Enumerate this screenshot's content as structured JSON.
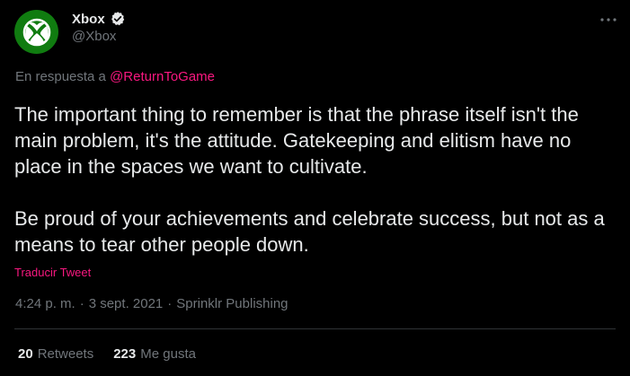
{
  "author": {
    "display_name": "Xbox",
    "handle": "@Xbox",
    "verified": true,
    "avatar_icon": "xbox-logo-icon",
    "avatar_color": "#107c10"
  },
  "reply": {
    "prefix": "En respuesta a",
    "mention": "@ReturnToGame"
  },
  "tweet": {
    "text": "The important thing to remember is that the phrase itself isn't the main problem, it's the attitude. Gatekeeping and elitism have no place in the spaces we want to cultivate.\n\nBe proud of your achievements and celebrate success, but not as a means to tear other people down.",
    "translate_label": "Traducir Tweet"
  },
  "meta": {
    "time": "4:24 p. m.",
    "sep1": "·",
    "date": "3 sept. 2021",
    "sep2": "·",
    "source": "Sprinklr Publishing"
  },
  "stats": {
    "retweets_count": "20",
    "retweets_label": "Retweets",
    "likes_count": "223",
    "likes_label": "Me gusta"
  },
  "colors": {
    "background": "#000000",
    "text": "#e7e9ea",
    "secondary": "#71767b",
    "accent": "#f91880",
    "verified": "#e7e9ea",
    "divider": "#2f3336"
  }
}
